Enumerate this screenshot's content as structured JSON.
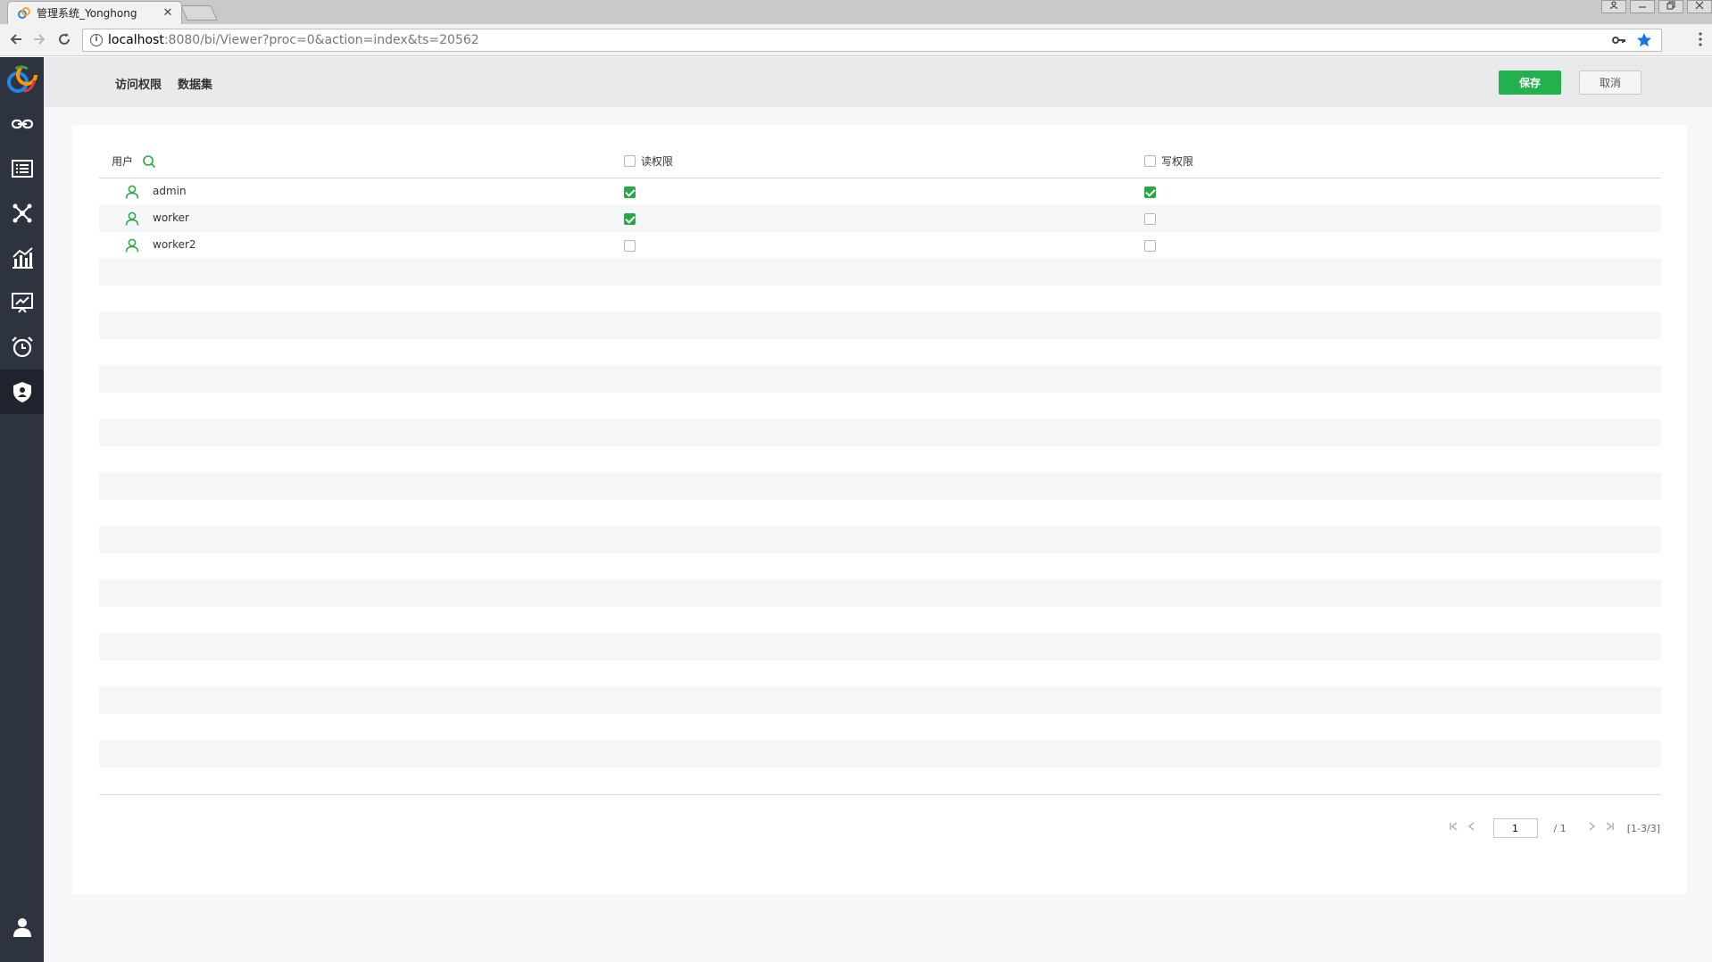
{
  "browser": {
    "tab_title": "管理系统_Yonghong",
    "tab_close": "✕",
    "url_host": "localhost",
    "url_rest": ":8080/bi/Viewer?proc=0&action=index&ts=20562"
  },
  "header": {
    "tabs": [
      {
        "label": "访问权限"
      },
      {
        "label": "数据集"
      }
    ],
    "save_label": "保存",
    "cancel_label": "取消"
  },
  "table": {
    "col_user": "用户",
    "col_read": "读权限",
    "col_write": "写权限",
    "rows": [
      {
        "name": "admin",
        "read": true,
        "write": true
      },
      {
        "name": "worker",
        "read": true,
        "write": false
      },
      {
        "name": "worker2",
        "read": false,
        "write": false
      }
    ]
  },
  "pager": {
    "current_page": "1",
    "total_pages": "/ 1",
    "range": "[1-3/3]"
  },
  "colors": {
    "accent": "#22b14c",
    "sidebar": "#2e3340"
  }
}
